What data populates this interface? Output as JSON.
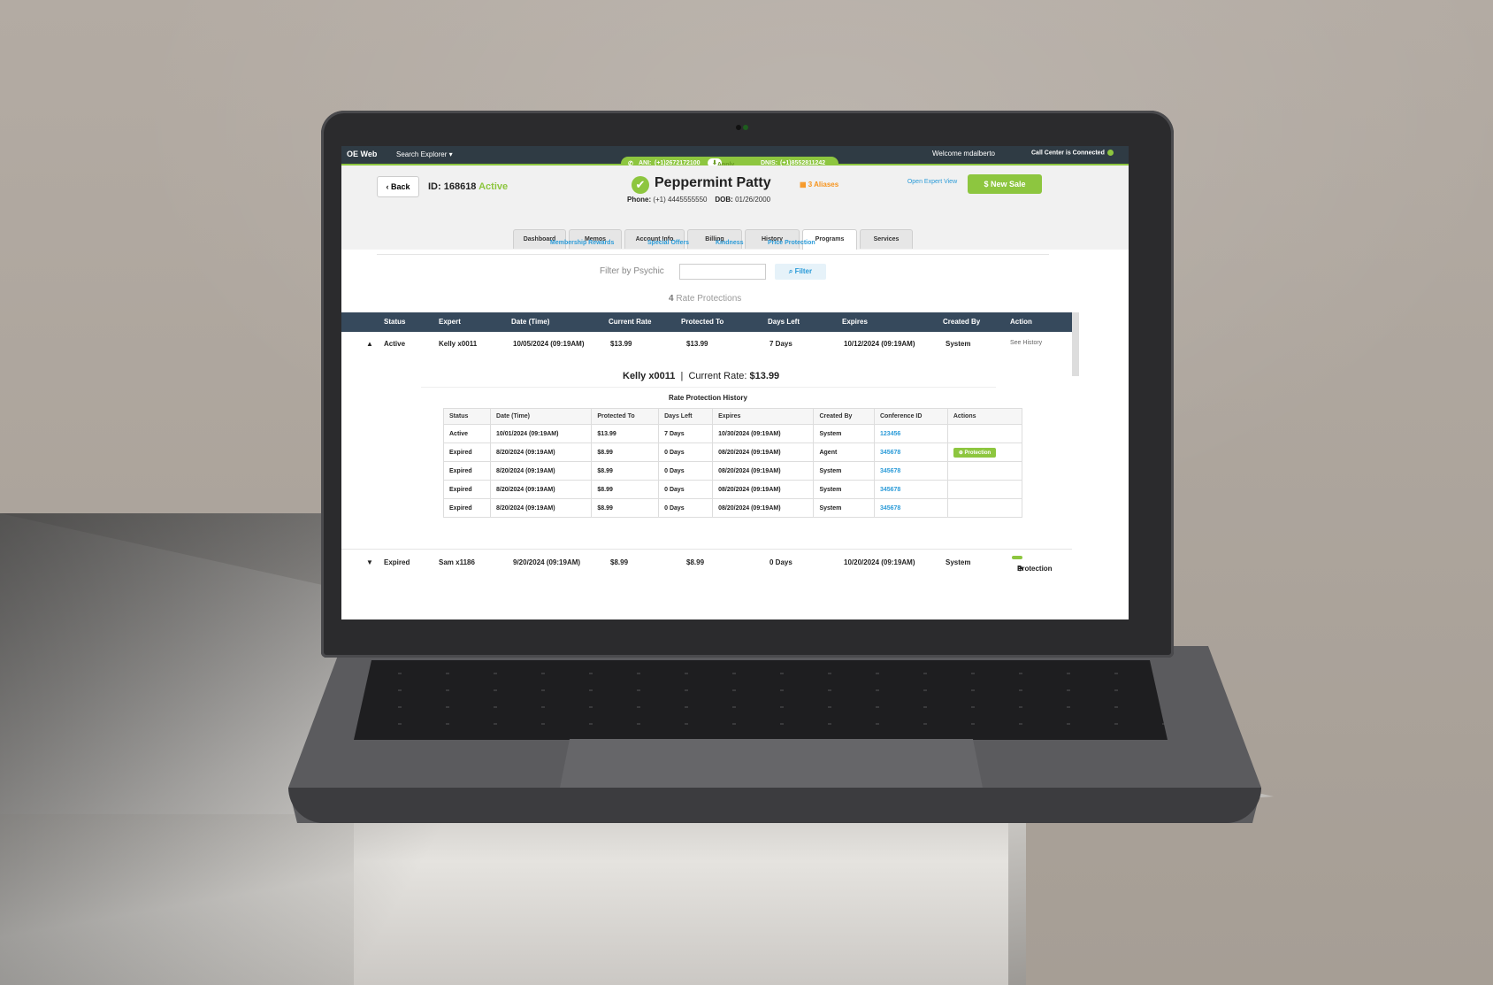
{
  "topbar": {
    "app": "OE Web",
    "explorer": "Search Explorer ▾",
    "ani_label": "ANI:",
    "ani_value": "(+1)2672172100",
    "apply_ani": "Apply ANI",
    "dnis_label": "DNIS:",
    "dnis_value": "(+1)8552811242",
    "welcome": "Welcome mdalberto",
    "call_center": "Call Center is Connected"
  },
  "header": {
    "back": "Back",
    "id_label": "ID: 168618",
    "status": "Active",
    "name": "Peppermint Patty",
    "aliases": "3 Aliases",
    "phone_label": "Phone:",
    "phone": "(+1) 4445555550",
    "dob_label": "DOB:",
    "dob": "01/26/2000",
    "open_expert_view": "Open Expert View",
    "new_sale": "New Sale"
  },
  "tabs": [
    "Dashboard",
    "Memos",
    "Account Info",
    "Billing",
    "History",
    "Programs",
    "Services"
  ],
  "subnav": [
    "Membership Rewards",
    "Special Offers",
    "Kindness",
    "Price Protection"
  ],
  "filter": {
    "label": "Filter by Psychic",
    "button": "Filter"
  },
  "count": {
    "number": "4",
    "text": "Rate Protections"
  },
  "columns": [
    "Status",
    "Expert",
    "Date (Time)",
    "Current Rate",
    "Protected To",
    "Days Left",
    "Expires",
    "Created By",
    "Action"
  ],
  "row1": {
    "status": "Active",
    "expert": "Kelly x0011",
    "date": "10/05/2024 (09:19AM)",
    "current_rate": "$13.99",
    "protected_to": "$13.99",
    "days_left": "7 Days",
    "expires": "10/12/2024 (09:19AM)",
    "created_by": "System",
    "action": "See History"
  },
  "detail": {
    "expert": "Kelly x0011",
    "rate_label": "Current Rate:",
    "rate": "$13.99",
    "history_title": "Rate Protection History",
    "history_columns": [
      "Status",
      "Date (Time)",
      "Protected To",
      "Days Left",
      "Expires",
      "Created By",
      "Conference ID",
      "Actions"
    ],
    "history": [
      [
        "Active",
        "10/01/2024 (09:19AM)",
        "$13.99",
        "7 Days",
        "10/30/2024 (09:19AM)",
        "System",
        "123456",
        ""
      ],
      [
        "Expired",
        "8/20/2024 (09:19AM)",
        "$8.99",
        "0 Days",
        "08/20/2024 (09:19AM)",
        "Agent",
        "345678",
        "Protection"
      ],
      [
        "Expired",
        "8/20/2024 (09:19AM)",
        "$8.99",
        "0 Days",
        "08/20/2024 (09:19AM)",
        "System",
        "345678",
        ""
      ],
      [
        "Expired",
        "8/20/2024 (09:19AM)",
        "$8.99",
        "0 Days",
        "08/20/2024 (09:19AM)",
        "System",
        "345678",
        ""
      ],
      [
        "Expired",
        "8/20/2024 (09:19AM)",
        "$8.99",
        "0 Days",
        "08/20/2024 (09:19AM)",
        "System",
        "345678",
        ""
      ]
    ]
  },
  "row2": {
    "status": "Expired",
    "expert": "Sam x1186",
    "date": "9/20/2024 (09:19AM)",
    "current_rate": "$8.99",
    "protected_to": "$8.99",
    "days_left": "0 Days",
    "expires": "10/20/2024 (09:19AM)",
    "created_by": "System",
    "action": "Protection"
  },
  "colors": {
    "green": "#8dc63f",
    "navy": "#36495c",
    "link": "#2b9bd8",
    "orange": "#f7941d"
  }
}
